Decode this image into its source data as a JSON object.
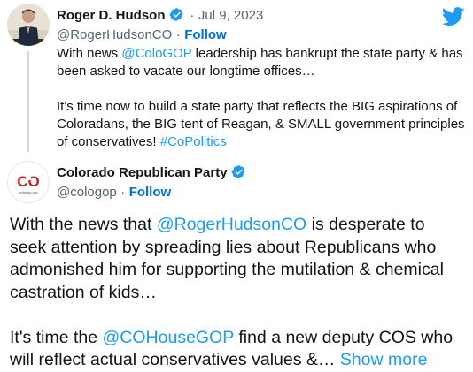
{
  "tweet1": {
    "name": "Roger D. Hudson",
    "handle": "@RogerHudsonCO",
    "date": "Jul 9, 2023",
    "separator": "·",
    "follow": "Follow",
    "p1_a": "With news ",
    "p1_mention": "@ColoGOP",
    "p1_b": " leadership has bankrupt the state party & has been asked to vacate our longtime offices…",
    "p2_a": "It's time now to build a state party that reflects the BIG aspirations of Coloradans, the BIG tent of Reagan, & SMALL government principles of conservatives! ",
    "p2_hashtag": "#CoPolitics"
  },
  "tweet2": {
    "name": "Colorado Republican Party",
    "handle": "@cologop",
    "separator": "·",
    "follow": "Follow",
    "avatar_text": "CO",
    "avatar_subtext": "cologop.org",
    "p1_a": "With the news that ",
    "p1_mention": "@RogerHudsonCO",
    "p1_b": " is desperate to seek attention by spreading lies about Republicans who admonished him for supporting the mutilation & chemical castration of kids…",
    "p2_a": "It's time the ",
    "p2_mention": "@COHouseGOP",
    "p2_b": " find a new deputy COS who will reflect actual conservatives values &… ",
    "show_more": "Show more"
  },
  "icons": {
    "verified": "verified-badge-icon",
    "twitter": "twitter-bird-icon"
  },
  "colors": {
    "link": "#1d9bf0",
    "follow": "#006fd6",
    "verified": "#1d9bf0",
    "avatar_red": "#c8202e"
  }
}
